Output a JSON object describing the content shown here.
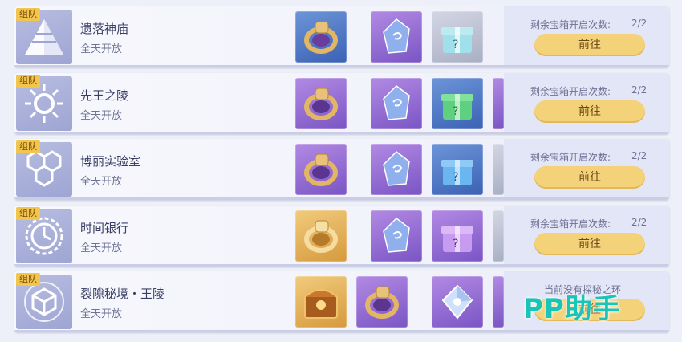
{
  "rows": [
    {
      "tag": "组队",
      "emblem_icon": "pyramid-icon",
      "title": "遗落神庙",
      "subtitle": "全天开放",
      "items": [
        "ring-blue",
        "gem-purple",
        "giftbox-gray"
      ],
      "status_label": "剩余宝箱开启次数:",
      "status_value": "2/2",
      "button": "前往"
    },
    {
      "tag": "组队",
      "emblem_icon": "sun-icon",
      "title": "先王之陵",
      "subtitle": "全天开放",
      "items": [
        "ring-purple",
        "gem-purple",
        "giftbox-green"
      ],
      "status_label": "剩余宝箱开启次数:",
      "status_value": "2/2",
      "button": "前往"
    },
    {
      "tag": "组队",
      "emblem_icon": "hexagon-icon",
      "title": "博丽实验室",
      "subtitle": "全天开放",
      "items": [
        "ring-purple",
        "gem-purple",
        "giftbox-blue"
      ],
      "status_label": "剩余宝箱开启次数:",
      "status_value": "2/2",
      "button": "前往"
    },
    {
      "tag": "组队",
      "emblem_icon": "clock-icon",
      "title": "时间银行",
      "subtitle": "全天开放",
      "items": [
        "ring-gold",
        "gem-purple",
        "giftbox-purple"
      ],
      "status_label": "剩余宝箱开启次数:",
      "status_value": "2/2",
      "button": "前往"
    },
    {
      "tag": "组队",
      "emblem_icon": "cube-icon",
      "title": "裂隙秘境・王陵",
      "subtitle": "全天开放",
      "items": [
        "chest-gold",
        "ring-purple",
        "crystal-purple"
      ],
      "status_message": "当前没有探秘之环",
      "button": "前往"
    }
  ],
  "watermark": "PP助手"
}
